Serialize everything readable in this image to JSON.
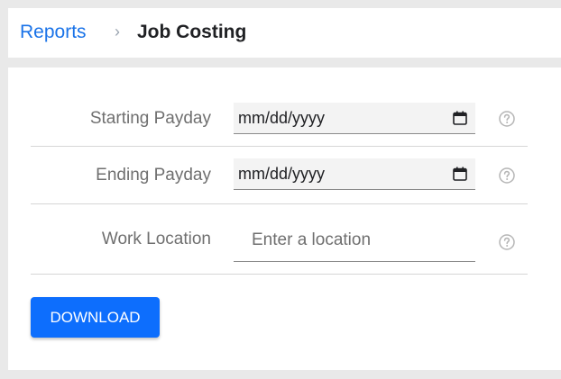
{
  "breadcrumb": {
    "parent_label": "Reports",
    "separator": "›",
    "current_label": "Job Costing"
  },
  "form": {
    "starting_payday": {
      "label": "Starting Payday",
      "value": "mm/dd/yyyy",
      "icon": "calendar-icon",
      "help_icon": "question-circle-icon"
    },
    "ending_payday": {
      "label": "Ending Payday",
      "value": "mm/dd/yyyy",
      "icon": "calendar-icon",
      "help_icon": "question-circle-icon"
    },
    "work_location": {
      "label": "Work Location",
      "placeholder": "Enter a location",
      "value": "",
      "help_icon": "question-circle-icon"
    }
  },
  "actions": {
    "download_label": "DOWNLOAD"
  },
  "colors": {
    "accent": "#0d6efd",
    "link": "#1a73e8",
    "label": "#6f6f6f",
    "background": "#e9e9e9"
  }
}
